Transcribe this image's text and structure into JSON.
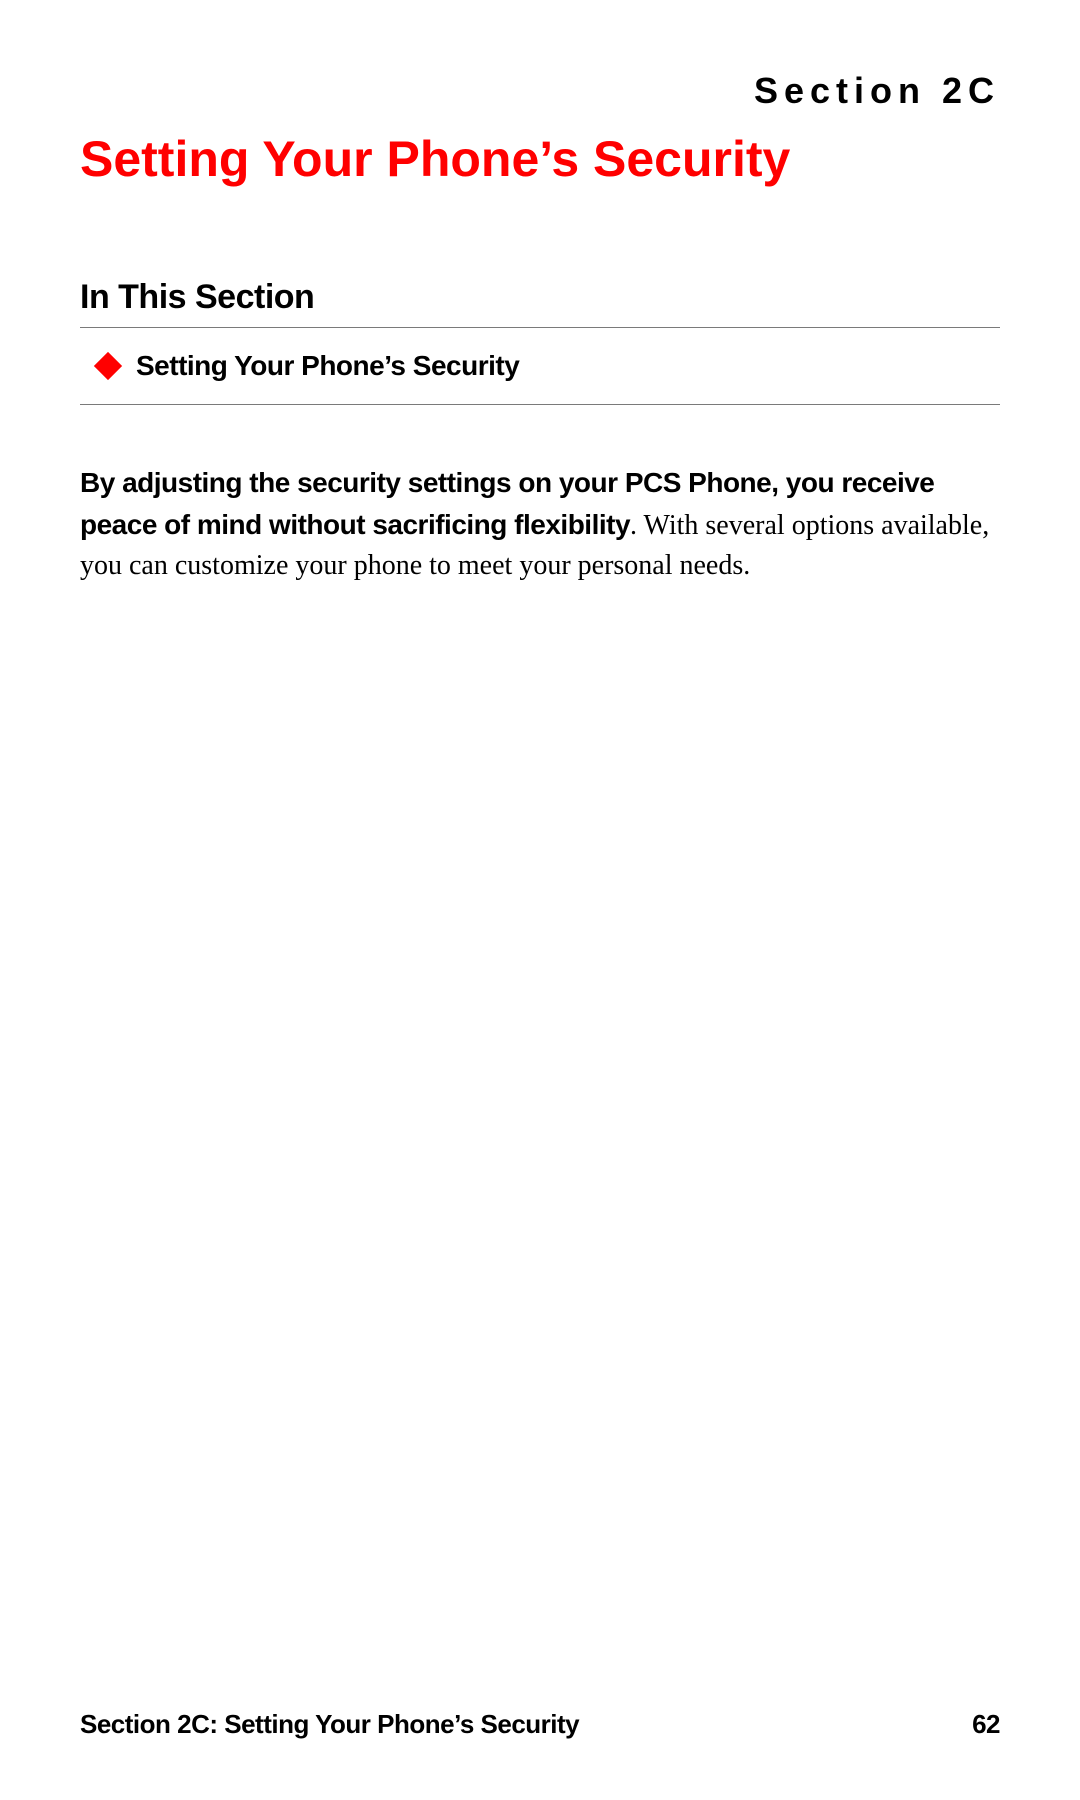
{
  "header": {
    "section_label": "Section 2C",
    "title": "Setting Your Phone’s Security"
  },
  "toc": {
    "heading": "In This Section",
    "items": [
      {
        "label": "Setting Your Phone’s Security"
      }
    ]
  },
  "body": {
    "lead_bold": "By adjusting the security settings on your PCS Phone, you receive peace of mind without sacrificing flexibility",
    "lead_rest": ". With several options available, you can customize your phone to meet your personal needs."
  },
  "footer": {
    "left": "Section 2C: Setting Your Phone’s Security",
    "page": "62"
  }
}
